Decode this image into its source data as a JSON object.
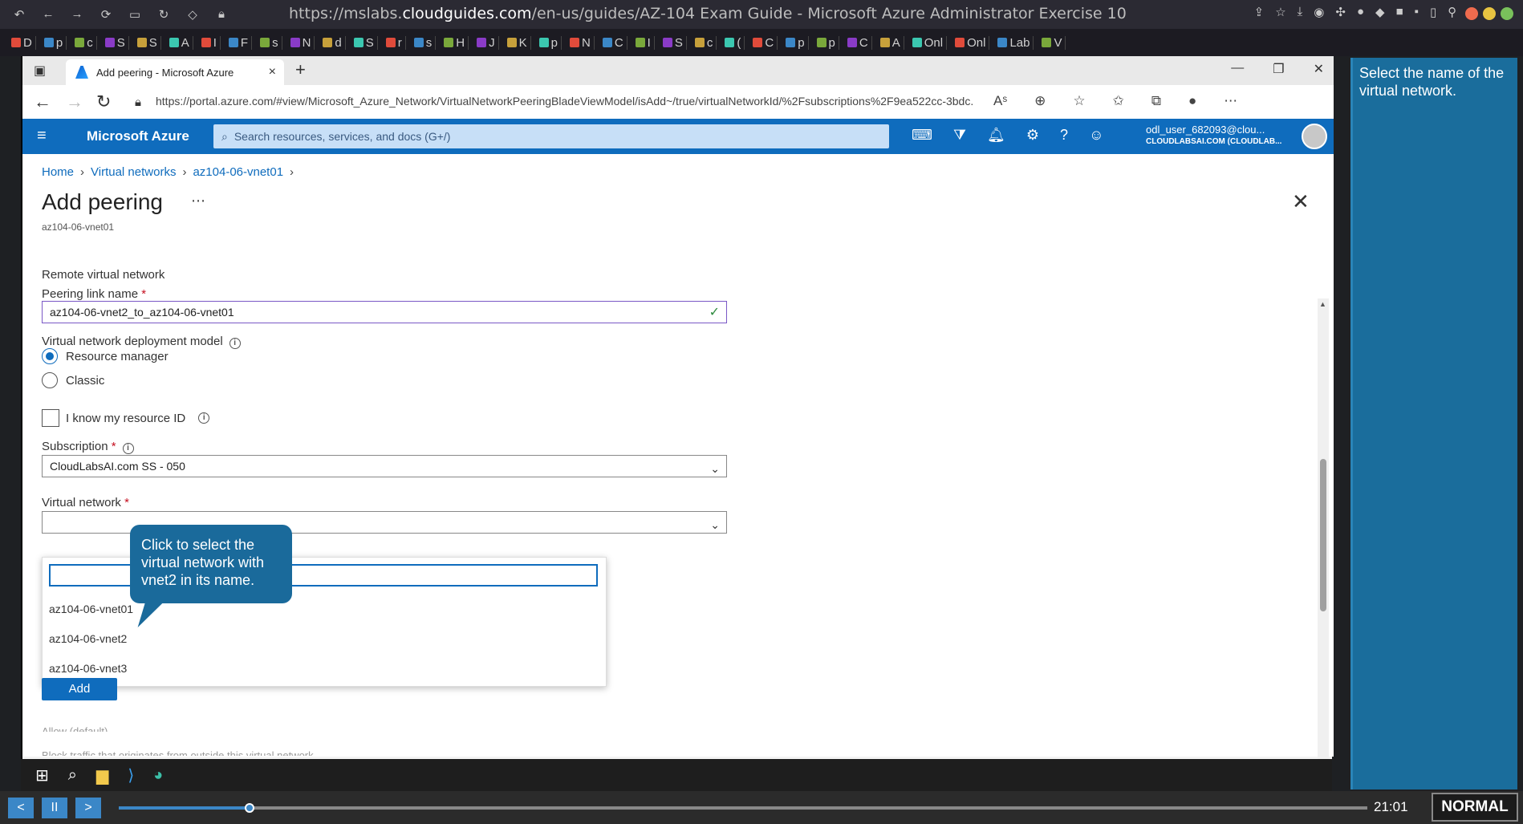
{
  "outer_browser": {
    "url_prefix": "https://mslabs.",
    "url_domain": "cloudguides.com",
    "url_rest": "/en-us/guides/AZ-104 Exam Guide - Microsoft Azure Administrator Exercise 10",
    "tabs": [
      "D",
      "p",
      "c",
      "S",
      "S",
      "A",
      "I",
      "F",
      "s",
      "N",
      "d",
      "S",
      "r",
      "s",
      "H",
      "J",
      "K",
      "p",
      "N",
      "C",
      "I",
      "S",
      "c",
      "(",
      "C",
      "p",
      "p",
      "C",
      "A",
      "Onl",
      "Onl",
      "Lab",
      "V"
    ],
    "window_dot_colors": [
      "#ef6b4e",
      "#e8c441",
      "#79c15b"
    ]
  },
  "edge": {
    "tab_title": "Add peering - Microsoft Azure",
    "url": "https://portal.azure.com/#view/Microsoft_Azure_Network/VirtualNetworkPeeringBladeViewModel/isAdd~/true/virtualNetworkId/%2Fsubscriptions%2F9ea522cc-3bdc..."
  },
  "azure": {
    "brand": "Microsoft Azure",
    "search_placeholder": "Search resources, services, and docs (G+/)",
    "user": "odl_user_682093@clou...",
    "tenant": "CLOUDLABSAI.COM (CLOUDLAB..."
  },
  "breadcrumb": [
    "Home",
    "Virtual networks",
    "az104-06-vnet01"
  ],
  "page": {
    "title": "Add peering",
    "subtitle": "az104-06-vnet01",
    "section_label": "Remote virtual network",
    "peering_link_label": "Peering link name",
    "peering_link_value": "az104-06-vnet2_to_az104-06-vnet01",
    "deployment_label": "Virtual network deployment model",
    "radio_rm": "Resource manager",
    "radio_classic": "Classic",
    "know_resource_id": "I know my resource ID",
    "subscription_label": "Subscription",
    "subscription_value": "CloudLabsAI.com SS - 050",
    "vnet_label": "Virtual network",
    "dropdown_options": [
      "az104-06-vnet01",
      "az104-06-vnet2",
      "az104-06-vnet3"
    ],
    "partial_row_1": "Allow (default)",
    "partial_row_2": "Block traffic that originates from outside this virtual network",
    "add_button": "Add"
  },
  "tooltip": "Click to select the virtual network with vnet2 in its name.",
  "guide_text": "Select the name of the virtual network.",
  "player": {
    "time": "21:01",
    "mode": "NORMAL",
    "progress": 0.105,
    "accent": "#3b87c7"
  }
}
